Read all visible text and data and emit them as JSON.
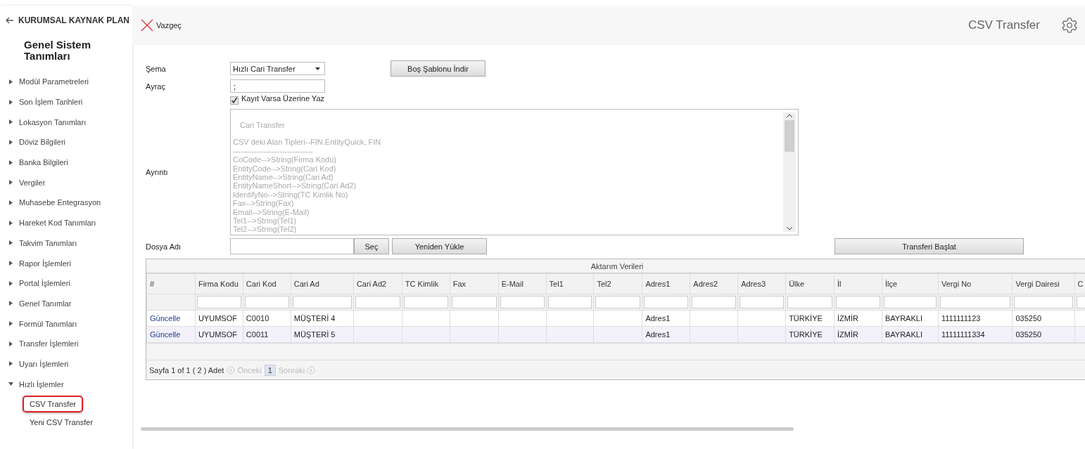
{
  "sidebar": {
    "back_label": "KURUMSAL KAYNAK PLAN",
    "title": "Genel Sistem Tanımları",
    "items": [
      {
        "label": "Modül Parametreleri",
        "expanded": false
      },
      {
        "label": "Son İşlem Tarihleri",
        "expanded": false
      },
      {
        "label": "Lokasyon Tanımları",
        "expanded": false
      },
      {
        "label": "Döviz Bilgileri",
        "expanded": false
      },
      {
        "label": "Banka Bilgileri",
        "expanded": false
      },
      {
        "label": "Vergiler",
        "expanded": false
      },
      {
        "label": "Muhasebe Entegrasyon",
        "expanded": false
      },
      {
        "label": "Hareket Kod Tanımları",
        "expanded": false
      },
      {
        "label": "Takvim Tanımları",
        "expanded": false
      },
      {
        "label": "Rapor İşlemleri",
        "expanded": false
      },
      {
        "label": "Portal İşlemleri",
        "expanded": false
      },
      {
        "label": "Genel Tanımlar",
        "expanded": false
      },
      {
        "label": "Formül Tanımları",
        "expanded": false
      },
      {
        "label": "Transfer İşlemleri",
        "expanded": false
      },
      {
        "label": "Uyarı İşlemleri",
        "expanded": false
      },
      {
        "label": "Hızlı İşlemler",
        "expanded": true,
        "children": [
          {
            "label": "CSV Transfer",
            "selected": true
          },
          {
            "label": "Yeni CSV Transfer",
            "selected": false
          }
        ]
      }
    ]
  },
  "toolbar": {
    "cancel_label": "Vazgeç",
    "page_title": "CSV Transfer"
  },
  "form": {
    "schema_label": "Şema",
    "schema_value": "Hızlı Cari Transfer",
    "template_button": "Boş Şablonu İndir",
    "separator_label": "Ayraç",
    "separator_value": ";",
    "overwrite": {
      "label": "Kayıt Varsa Üzerine Yaz",
      "checked": true
    },
    "detail_label": "Ayrıntı",
    "detail_title": "Cari Transfer",
    "detail_lines": [
      "CSV deki Alan Tipleri--FIN.EntityQuick, FIN",
      "-------------------------------",
      "CoCode-->String(Firma Kodu)",
      "EntityCode-->String(Cari Kod)",
      "EntityName-->String(Cari Ad)",
      "EntityNameShort-->String(Cari Ad2)",
      "IdentifyNo-->String(TC Kimlik No)",
      "Fax-->String(Fax)",
      "Email-->String(E-Mail)",
      "Tel1-->String(Tel1)",
      "Tel2-->String(Tel2)"
    ],
    "file_label": "Dosya Adı",
    "choose_button": "Seç",
    "reload_button": "Yeniden Yükle",
    "start_button": "Transferi Başlat"
  },
  "grid": {
    "title": "Aktarım Verileri",
    "columns": [
      "#",
      "Firma Kodu",
      "Cari Kod",
      "Cari Ad",
      "Cari Ad2",
      "TC Kimlik",
      "Fax",
      "E-Mail",
      "Tel1",
      "Tel2",
      "Adres1",
      "Adres2",
      "Adres3",
      "Ülke",
      "İl",
      "İlçe",
      "Vergi No",
      "Vergi Dairesi",
      "C"
    ],
    "rows": [
      {
        "cells": [
          "Güncelle",
          "UYUMSOF",
          "C0010",
          "MÜŞTERİ 4",
          "",
          "",
          "",
          "",
          "",
          "",
          "Adres1",
          "",
          "",
          "TÜRKİYE",
          "İZMİR",
          "BAYRAKLI",
          "1111111123",
          "035250",
          ""
        ]
      },
      {
        "cells": [
          "Güncelle",
          "UYUMSOF",
          "C0011",
          "MÜŞTERİ 5",
          "",
          "",
          "",
          "",
          "",
          "",
          "Adres1",
          "",
          "",
          "TÜRKİYE",
          "İZMİR",
          "BAYRAKLI",
          "11111111334",
          "035250",
          ""
        ]
      }
    ],
    "pager": {
      "summary": "Sayfa 1 of 1 ( 2 ) Adet",
      "prev": "Önceki",
      "page": "1",
      "next": "Sonraki"
    }
  }
}
